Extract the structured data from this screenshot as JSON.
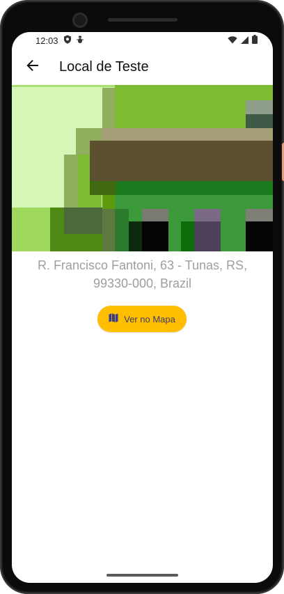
{
  "status_bar": {
    "time": "12:03",
    "icons_left": [
      "shield-icon",
      "debug-icon"
    ],
    "icons_right": [
      "wifi-icon",
      "signal-icon",
      "battery-icon"
    ]
  },
  "app_bar": {
    "back_icon": "arrow-back-icon",
    "title": "Local de Teste"
  },
  "hero": {
    "description_icon": "location-image"
  },
  "location": {
    "address": "R. Francisco Fantoni, 63 - Tunas, RS, 99330-000, Brazil"
  },
  "actions": {
    "map_button_label": "Ver no Mapa",
    "map_button_icon": "map-icon",
    "map_button_color": "#ffbf00"
  }
}
